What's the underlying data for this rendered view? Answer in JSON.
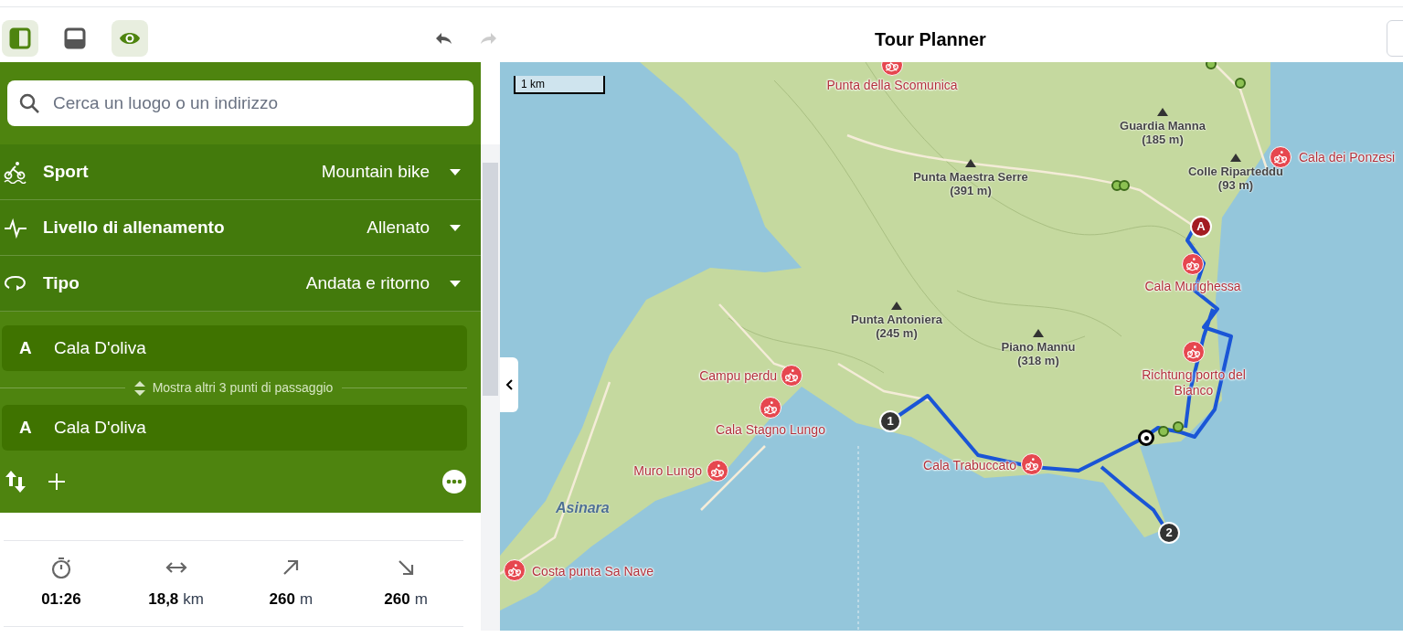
{
  "toolbar": {
    "view_buttons": [
      {
        "kind": "sidebar",
        "selected": true
      },
      {
        "kind": "bottom-panel",
        "selected": false
      },
      {
        "kind": "eye",
        "selected": true
      }
    ],
    "undo": {
      "disabled": false
    },
    "redo": {
      "disabled": true
    }
  },
  "title": "Tour Planner",
  "search": {
    "placeholder": "Cerca un luogo o un indirizzo"
  },
  "settings": [
    {
      "kind": "sport",
      "label": "Sport",
      "value": "Mountain bike"
    },
    {
      "kind": "fitness",
      "label": "Livello di allenamento",
      "value": "Allenato"
    },
    {
      "kind": "type",
      "label": "Tipo",
      "value": "Andata e ritorno"
    }
  ],
  "waypoints": [
    {
      "letter": "A",
      "name": "Cala D'oliva"
    },
    {
      "letter": "A",
      "name": "Cala D'oliva"
    }
  ],
  "show_more": "Mostra altri 3 punti di passaggio",
  "stats": [
    {
      "kind": "time",
      "value": "01:26"
    },
    {
      "kind": "distance",
      "value": "18,8",
      "unit": "km"
    },
    {
      "kind": "ascent",
      "value": "260",
      "unit": "m"
    },
    {
      "kind": "descent",
      "value": "260",
      "unit": "m"
    }
  ],
  "map": {
    "scale": "1 km",
    "place": "Asinara",
    "pois": [
      "Punta della Scomunica",
      "Cala dei Ponzesi",
      "Cala Murighessa",
      "Campu perdu",
      "Richtung porto del Bianco",
      "Cala Stagno Lungo",
      "Muro Lungo",
      "Cala Trabuccato",
      "Costa punta Sa Nave"
    ],
    "peaks": [
      {
        "name": "Punta Maestra Serre",
        "elevation": "(391 m)"
      },
      {
        "name": "Guardia Manna",
        "elevation": "(185 m)"
      },
      {
        "name": "Colle Riparteddu",
        "elevation": "(93 m)"
      },
      {
        "name": "Punta Antoniera",
        "elevation": "(245 m)"
      },
      {
        "name": "Piano Mannu",
        "elevation": "(318 m)"
      }
    ],
    "markers": [
      "A",
      "1",
      "2"
    ]
  }
}
